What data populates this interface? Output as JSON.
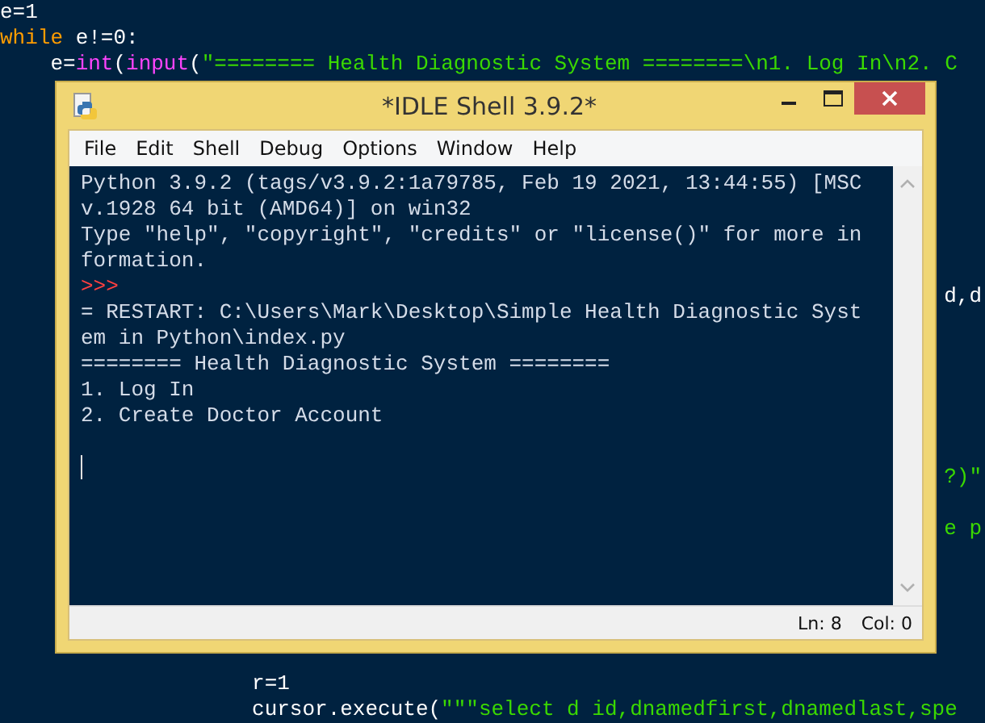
{
  "editor": {
    "lines": [
      {
        "kind": "code",
        "segments": [
          {
            "kind": "plain",
            "text": "e=1"
          }
        ]
      },
      {
        "kind": "code",
        "segments": [
          {
            "kind": "keyword",
            "text": "while"
          },
          {
            "kind": "plain",
            "text": " e!=0:"
          }
        ]
      },
      {
        "kind": "code",
        "segments": [
          {
            "kind": "plain",
            "text": "    e="
          },
          {
            "kind": "builtin",
            "text": "int"
          },
          {
            "kind": "plain",
            "text": "("
          },
          {
            "kind": "builtin",
            "text": "input"
          },
          {
            "kind": "plain",
            "text": "("
          },
          {
            "kind": "string",
            "text": "\"======== Health Diagnostic System ========\\n1. Log In\\n2. C"
          }
        ]
      },
      {
        "kind": "fragment",
        "segments": [
          {
            "kind": "plain",
            "text": "d,d"
          }
        ]
      },
      {
        "kind": "fragment",
        "segments": [
          {
            "kind": "string",
            "text": "?)\""
          }
        ]
      },
      {
        "kind": "fragment",
        "segments": [
          {
            "kind": "string",
            "text": "e p"
          }
        ]
      },
      {
        "kind": "code",
        "segments": [
          {
            "kind": "plain",
            "text": "                    r=1"
          }
        ]
      },
      {
        "kind": "code",
        "segments": [
          {
            "kind": "plain",
            "text": "                    cursor.execute("
          },
          {
            "kind": "string",
            "text": "\"\"\"select d id,dnamedfirst,dnamedlast,spe"
          }
        ]
      }
    ]
  },
  "window": {
    "title": "*IDLE Shell 3.9.2*",
    "menu": [
      "File",
      "Edit",
      "Shell",
      "Debug",
      "Options",
      "Window",
      "Help"
    ],
    "shell": {
      "lines": [
        {
          "kind": "output",
          "text": "Python 3.9.2 (tags/v3.9.2:1a79785, Feb 19 2021, 13:44:55) [MSC"
        },
        {
          "kind": "output",
          "text": "v.1928 64 bit (AMD64)] on win32"
        },
        {
          "kind": "output",
          "text": "Type \"help\", \"copyright\", \"credits\" or \"license()\" for more in"
        },
        {
          "kind": "output",
          "text": "formation."
        },
        {
          "kind": "prompt",
          "text": ">>>"
        },
        {
          "kind": "output",
          "text": "= RESTART: C:\\Users\\Mark\\Desktop\\Simple Health Diagnostic Syst"
        },
        {
          "kind": "output",
          "text": "em in Python\\index.py"
        },
        {
          "kind": "output",
          "text": "======== Health Diagnostic System ========"
        },
        {
          "kind": "output",
          "text": "1. Log In"
        },
        {
          "kind": "output",
          "text": "2. Create Doctor Account"
        }
      ]
    },
    "status_bar": {
      "line": "Ln: 8",
      "column": "Col: 0"
    }
  }
}
